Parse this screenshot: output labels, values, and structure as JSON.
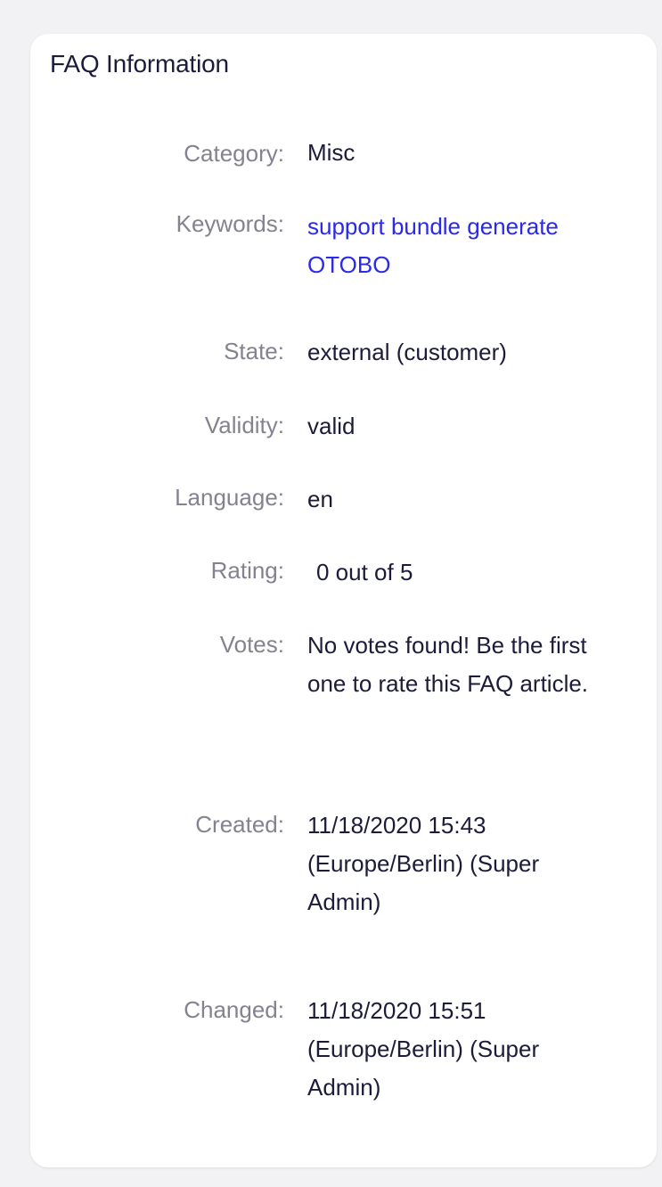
{
  "panel": {
    "title": "FAQ Information"
  },
  "fields": {
    "category": {
      "label": "Category:",
      "value": "Misc"
    },
    "keywords": {
      "label": "Keywords:",
      "value": "support bundle generate OTOBO"
    },
    "state": {
      "label": "State:",
      "value": "external (customer)"
    },
    "validity": {
      "label": "Validity:",
      "value": "valid"
    },
    "language": {
      "label": "Language:",
      "value": "en"
    },
    "rating": {
      "label": "Rating:",
      "value": "0 out of 5"
    },
    "votes": {
      "label": "Votes:",
      "value": "No votes found! Be the first one to rate this FAQ article."
    },
    "created": {
      "label": "Created:",
      "value": "11/18/2020 15:43 (Europe/Berlin) (Super Admin)"
    },
    "changed": {
      "label": "Changed:",
      "value": "11/18/2020 15:51 (Europe/Berlin) (Super Admin)"
    }
  },
  "colors": {
    "label": "#838390",
    "value": "#1c1c3a",
    "link": "#2a2ae8",
    "background": "#f2f2f4",
    "card": "#ffffff"
  }
}
